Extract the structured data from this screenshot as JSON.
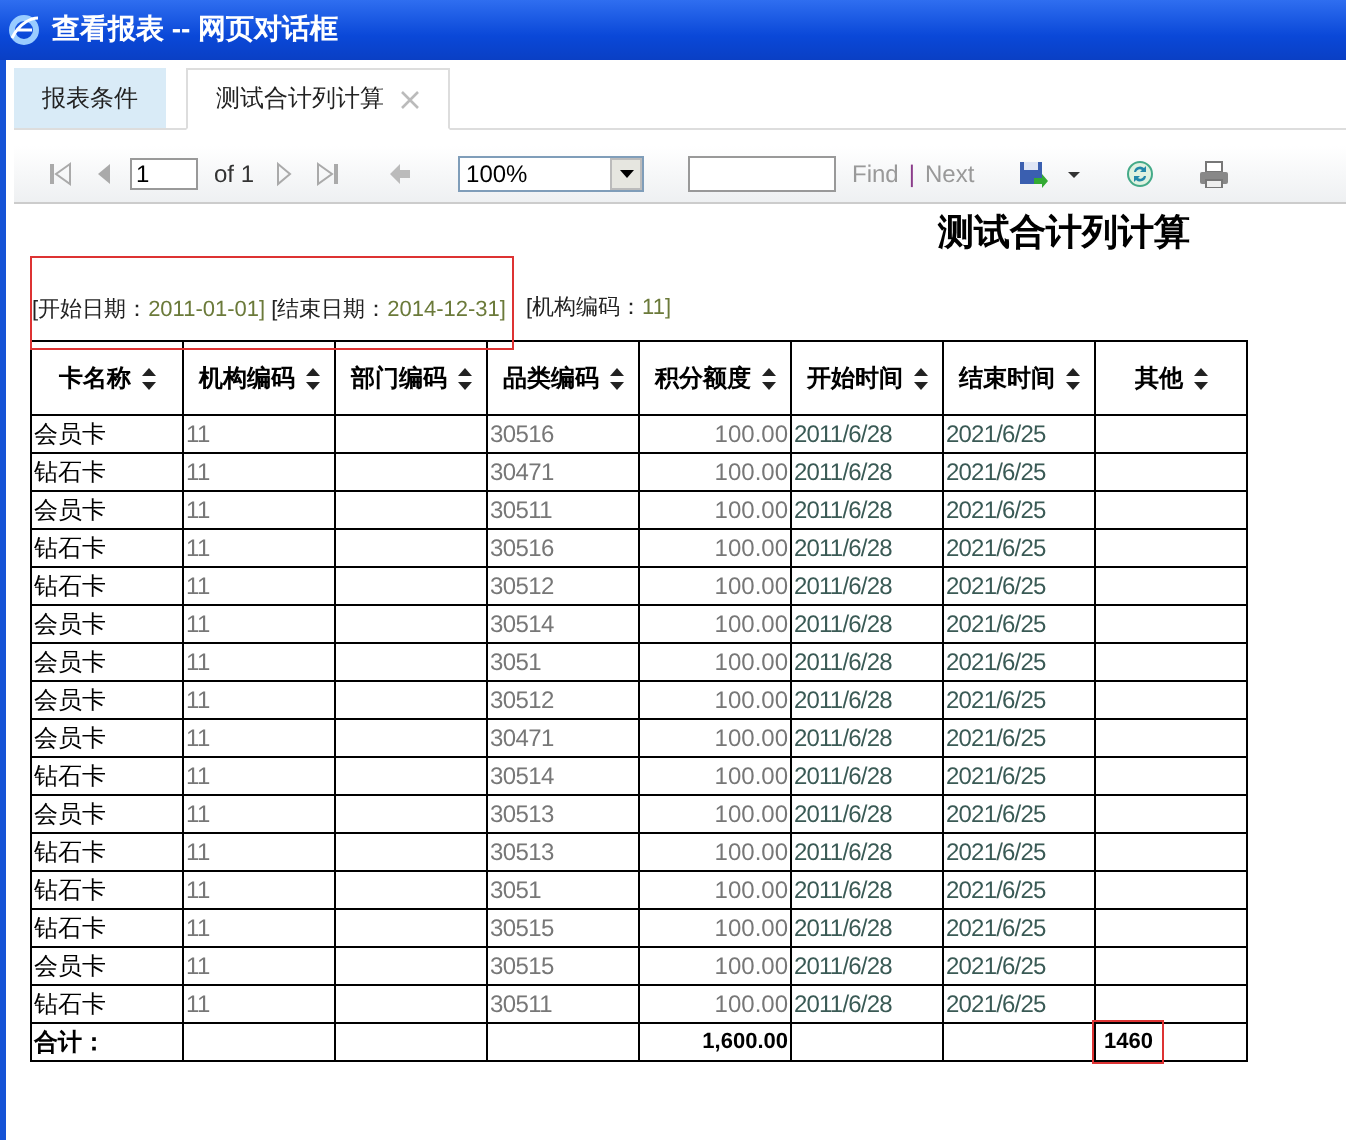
{
  "window": {
    "title": "查看报表 -- 网页对话框"
  },
  "tabs": [
    {
      "label": "报表条件",
      "selected": false,
      "closable": false
    },
    {
      "label": "测试合计列计算",
      "selected": true,
      "closable": true
    }
  ],
  "toolbar": {
    "page": "1",
    "of_label": "of 1",
    "zoom": "100%",
    "find_label": "Find",
    "separator": "|",
    "next_label": "Next"
  },
  "report": {
    "title": "测试合计列计算",
    "params": [
      {
        "label": "[开始日期：",
        "value": "2011-01-01]",
        "highlighted": true
      },
      {
        "label": "[结束日期：",
        "value": "2014-12-31]",
        "highlighted": true
      },
      {
        "label": "[机构编码：",
        "value": "11]",
        "highlighted": false
      }
    ],
    "columns": [
      "卡名称",
      "机构编码",
      "部门编码",
      "品类编码",
      "积分额度",
      "开始时间",
      "结束时间",
      "其他"
    ],
    "rows": [
      [
        "会员卡",
        "11",
        "",
        "30516",
        "100.00",
        "2011/6/28",
        "2021/6/25",
        ""
      ],
      [
        "钻石卡",
        "11",
        "",
        "30471",
        "100.00",
        "2011/6/28",
        "2021/6/25",
        ""
      ],
      [
        "会员卡",
        "11",
        "",
        "30511",
        "100.00",
        "2011/6/28",
        "2021/6/25",
        ""
      ],
      [
        "钻石卡",
        "11",
        "",
        "30516",
        "100.00",
        "2011/6/28",
        "2021/6/25",
        ""
      ],
      [
        "钻石卡",
        "11",
        "",
        "30512",
        "100.00",
        "2011/6/28",
        "2021/6/25",
        ""
      ],
      [
        "会员卡",
        "11",
        "",
        "30514",
        "100.00",
        "2011/6/28",
        "2021/6/25",
        ""
      ],
      [
        "会员卡",
        "11",
        "",
        "3051",
        "100.00",
        "2011/6/28",
        "2021/6/25",
        ""
      ],
      [
        "会员卡",
        "11",
        "",
        "30512",
        "100.00",
        "2011/6/28",
        "2021/6/25",
        ""
      ],
      [
        "会员卡",
        "11",
        "",
        "30471",
        "100.00",
        "2011/6/28",
        "2021/6/25",
        ""
      ],
      [
        "钻石卡",
        "11",
        "",
        "30514",
        "100.00",
        "2011/6/28",
        "2021/6/25",
        ""
      ],
      [
        "会员卡",
        "11",
        "",
        "30513",
        "100.00",
        "2011/6/28",
        "2021/6/25",
        ""
      ],
      [
        "钻石卡",
        "11",
        "",
        "30513",
        "100.00",
        "2011/6/28",
        "2021/6/25",
        ""
      ],
      [
        "钻石卡",
        "11",
        "",
        "3051",
        "100.00",
        "2011/6/28",
        "2021/6/25",
        ""
      ],
      [
        "钻石卡",
        "11",
        "",
        "30515",
        "100.00",
        "2011/6/28",
        "2021/6/25",
        ""
      ],
      [
        "会员卡",
        "11",
        "",
        "30515",
        "100.00",
        "2011/6/28",
        "2021/6/25",
        ""
      ],
      [
        "钻石卡",
        "11",
        "",
        "30511",
        "100.00",
        "2011/6/28",
        "2021/6/25",
        ""
      ]
    ],
    "total": {
      "label": "合计：",
      "points": "1,600.00",
      "other": "1460",
      "other_highlighted": true
    }
  }
}
